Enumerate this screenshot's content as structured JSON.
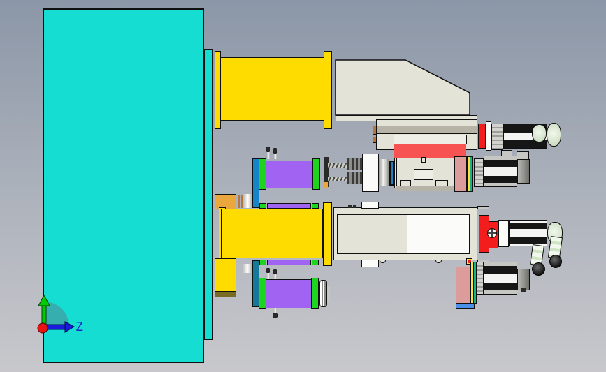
{
  "app": {
    "view": "cad-assembly-side-view"
  },
  "triad": {
    "label": "Z"
  },
  "colors": {
    "plate": "#15ddd1",
    "yellow": "#ffdc00",
    "beige": "#e4e3d8",
    "beige_light": "#efeee6",
    "beige_dark": "#b7b4a7",
    "white": "#fbfbf9",
    "red": "#f75353",
    "red_bright": "#f41d1d",
    "salmon": "#dd9c9c",
    "purple": "#a164f2",
    "green": "#1fd41f",
    "blue_plate": "#1584c8",
    "teal_plate": "#14799b",
    "blue_ring": "#1e7fc0",
    "blue_bar": "#4a8fe8",
    "teal_strip": "#16b28e",
    "yellow_strip": "#ffe03c",
    "orange": "#e9a73d",
    "olive": "#7a6b22",
    "copper": "#b4763a",
    "motor_black": "#161616",
    "motor_gray": "#c6c6c2",
    "motor_white": "#f4f4f2",
    "dark": "#2a2a28",
    "axis_green": "#00cc00",
    "axis_blue": "#1b1bdd",
    "axis_red": "#e81414",
    "axis_label_blue": "#2222cc"
  }
}
